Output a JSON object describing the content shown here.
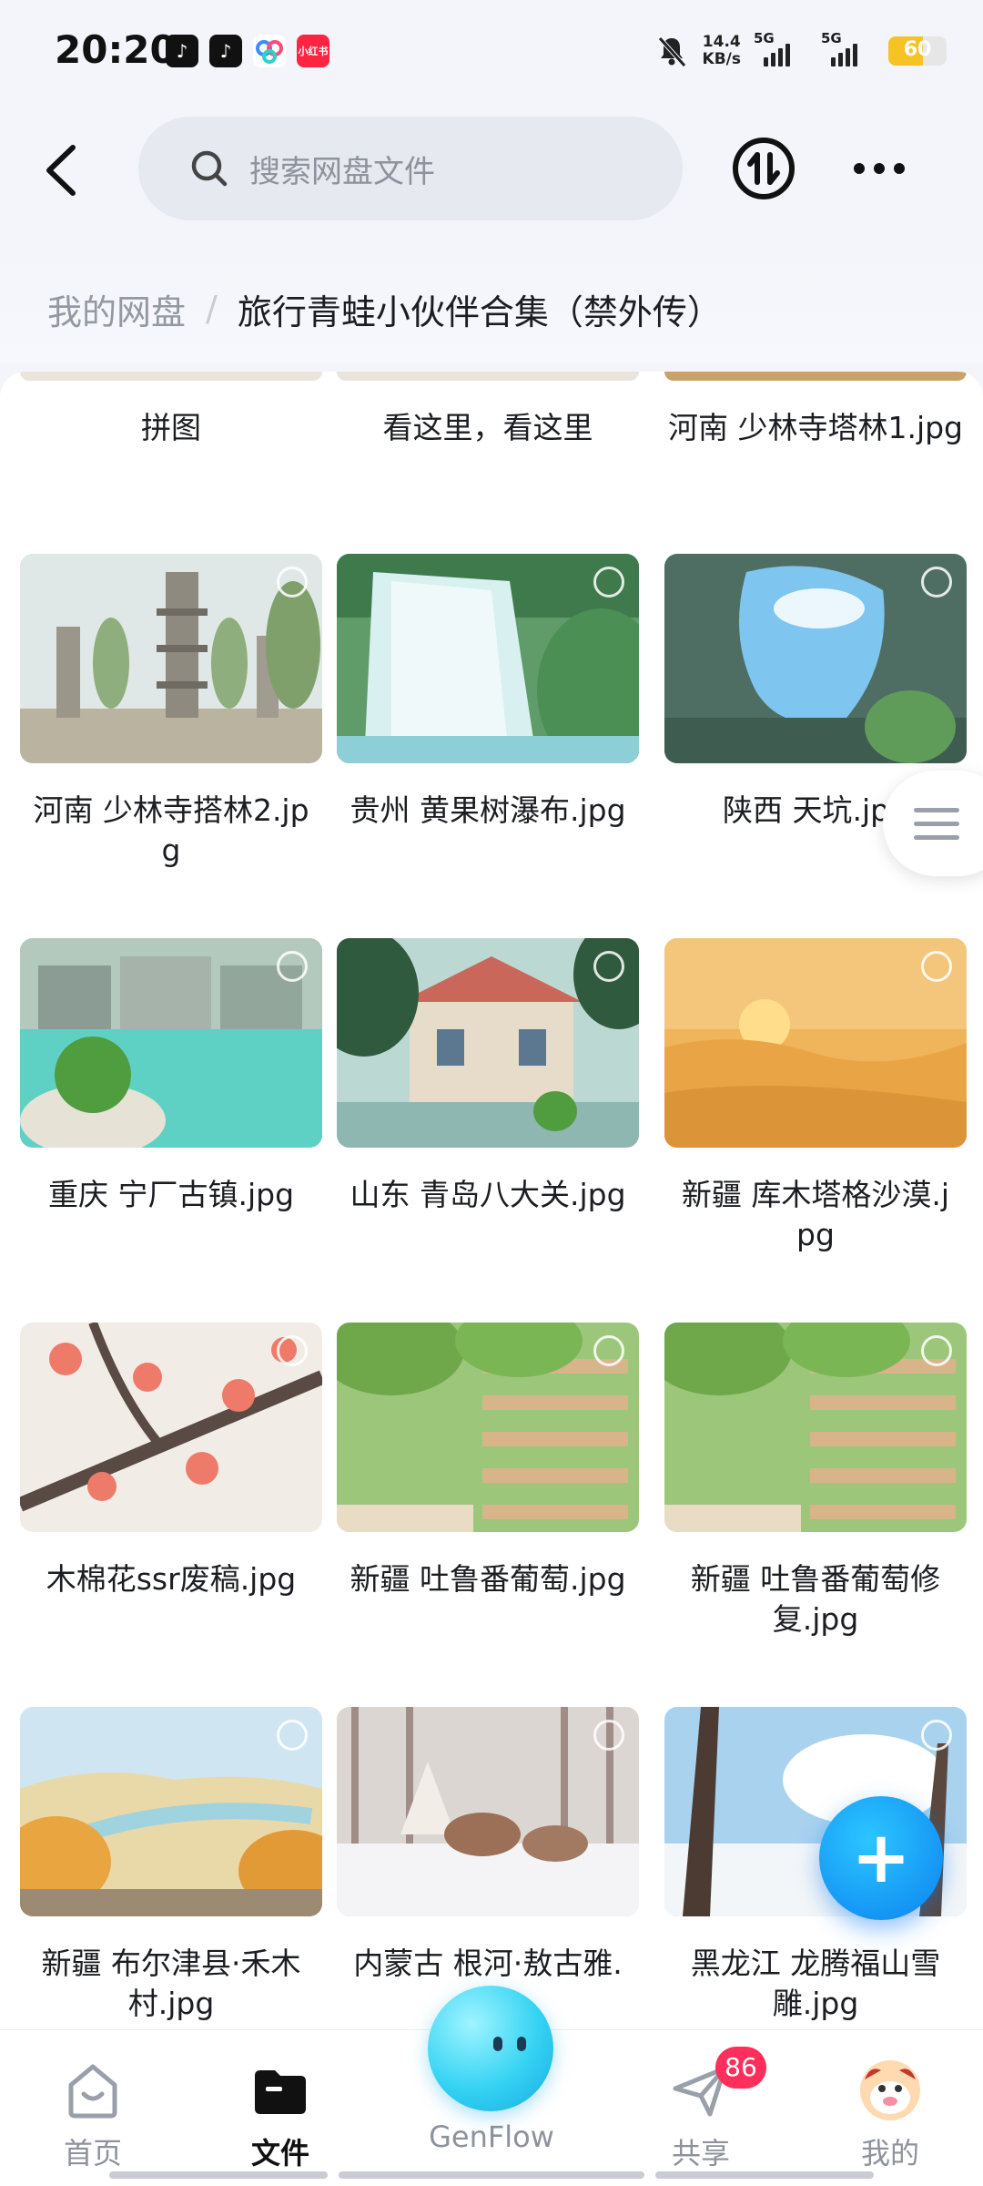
{
  "status_bar": {
    "time": "20:20",
    "app_icons": [
      "tiktok-icon",
      "tiktok-icon",
      "baidu-netdisk-icon",
      "xiaohongshu-icon"
    ],
    "xiaohongshu_label": "小红书",
    "net_speed_value": "14.4",
    "net_speed_unit": "KB/s",
    "signal_1_label": "5G",
    "signal_2_label": "5G",
    "battery_level": "60",
    "colors": {
      "battery": "#f6c325"
    }
  },
  "top_bar": {
    "search_placeholder": "搜索网盘文件"
  },
  "breadcrumb": {
    "root": "我的网盘",
    "separator": "/",
    "current": "旅行青蛙小伙伴合集（禁外传）"
  },
  "top_row_names": [
    "拼图",
    "看这里，看这里",
    "河南 少林寺塔林1.jpg"
  ],
  "files": [
    {
      "name": "河南 少林寺搭林2.jpg",
      "scene": "pagoda-forest"
    },
    {
      "name": "贵州 黄果树瀑布.jpg",
      "scene": "waterfall"
    },
    {
      "name": "陕西 天坑.jpg",
      "scene": "sinkhole"
    },
    {
      "name": "重庆 宁厂古镇.jpg",
      "scene": "river-town"
    },
    {
      "name": "山东 青岛八大关.jpg",
      "scene": "villa"
    },
    {
      "name": "新疆 库木塔格沙漠.jpg",
      "scene": "desert"
    },
    {
      "name": "木棉花ssr废稿.jpg",
      "scene": "kapok-flowers"
    },
    {
      "name": "新疆 吐鲁番葡萄.jpg",
      "scene": "grape-drying-house"
    },
    {
      "name": "新疆 吐鲁番葡萄修复.jpg",
      "scene": "grape-drying-house"
    },
    {
      "name": "新疆 布尔津县·禾木村.jpg",
      "scene": "autumn-valley"
    },
    {
      "name": "内蒙古 根河·敖古雅.jpg",
      "scene": "reindeer-snow"
    },
    {
      "name": "黑龙江 龙腾福山雪雕.jpg",
      "scene": "snow-forest"
    }
  ],
  "fab": {
    "label": "+"
  },
  "bottom_nav": [
    {
      "label": "首页",
      "icon": "home-icon",
      "active": false
    },
    {
      "label": "文件",
      "icon": "folder-icon",
      "active": true
    },
    {
      "label": "GenFlow",
      "icon": "genflow-orb-icon",
      "active": false
    },
    {
      "label": "共享",
      "icon": "share-icon",
      "active": false,
      "badge": "86"
    },
    {
      "label": "我的",
      "icon": "avatar-icon",
      "active": false
    }
  ]
}
